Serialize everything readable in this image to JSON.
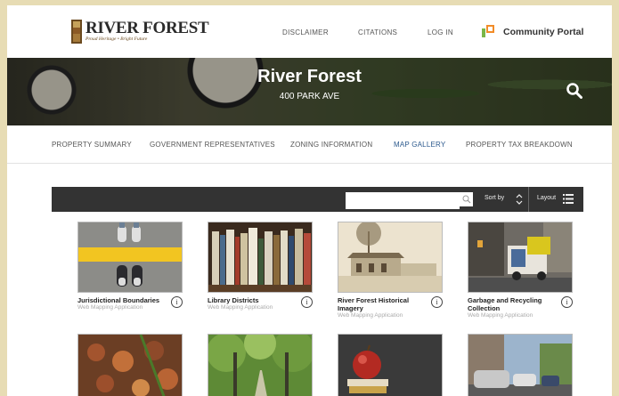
{
  "header": {
    "logo_title": "RIVER FOREST",
    "logo_tagline": "Proud Heritage • Bright Future",
    "nav": [
      "DISCLAIMER",
      "CITATIONS",
      "LOG IN"
    ],
    "portal_label": "Community Portal"
  },
  "hero": {
    "title": "River Forest",
    "address": "400 PARK AVE"
  },
  "tabs": [
    {
      "label": "PROPERTY SUMMARY",
      "active": false
    },
    {
      "label": "GOVERNMENT REPRESENTATIVES",
      "active": false
    },
    {
      "label": "ZONING INFORMATION",
      "active": false
    },
    {
      "label": "MAP GALLERY",
      "active": true
    },
    {
      "label": "PROPERTY TAX BREAKDOWN",
      "active": false
    }
  ],
  "toolbar": {
    "search_value": "",
    "sort_label": "Sort by",
    "layout_label": "Layout"
  },
  "gallery": {
    "items": [
      {
        "title": "Jurisdictional Boundaries",
        "subtitle": "Web Mapping Application",
        "thumb": "shoes-on-line"
      },
      {
        "title": "Library Districts",
        "subtitle": "Web Mapping Application",
        "thumb": "bookshelf"
      },
      {
        "title": "River Forest Historical Imagery",
        "subtitle": "Web Mapping Application",
        "thumb": "historic-building"
      },
      {
        "title": "Garbage and Recycling Collection",
        "subtitle": "Web Mapping Application",
        "thumb": "garbage-truck"
      },
      {
        "title": "",
        "subtitle": "",
        "thumb": "leaves-rake"
      },
      {
        "title": "",
        "subtitle": "",
        "thumb": "tree-lined-path"
      },
      {
        "title": "",
        "subtitle": "",
        "thumb": "apple-books"
      },
      {
        "title": "",
        "subtitle": "",
        "thumb": "parked-cars-street"
      }
    ]
  },
  "colors": {
    "page_background": "#e7dcb4",
    "toolbar": "#333333",
    "active_tab": "#2d5a8e",
    "portal_orange": "#f28c28",
    "portal_green": "#7ab648"
  }
}
